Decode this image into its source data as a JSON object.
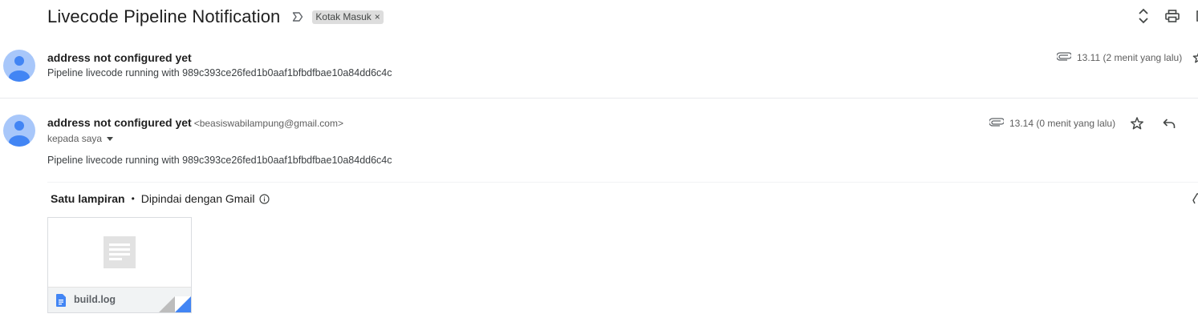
{
  "thread": {
    "subject": "Livecode Pipeline Notification",
    "label": "Kotak Masuk",
    "label_remove": "×"
  },
  "messages": [
    {
      "sender": "address not configured yet",
      "snippet": "Pipeline livecode running with 989c393ce26fed1b0aaf1bfbdfbae10a84dd6c4c",
      "time": "13.11 (2 menit yang lalu)"
    },
    {
      "sender": "address not configured yet",
      "email": "<beasiswabilampung@gmail.com>",
      "to": "kepada saya",
      "time": "13.14 (0 menit yang lalu)",
      "body": "Pipeline livecode running with 989c393ce26fed1b0aaf1bfbdfbae10a84dd6c4c"
    }
  ],
  "attachments": {
    "count_label": "Satu lampiran",
    "separator": "•",
    "scan_label": "Dipindai dengan Gmail",
    "files": [
      {
        "name": "build.log",
        "icon": "document-icon"
      }
    ]
  },
  "icons": {
    "importance": "label-important-outline-icon",
    "expand": "unfold-more-icon",
    "print": "print-icon",
    "new_window": "open-in-new-icon",
    "attachment": "paperclip-icon",
    "star": "star-outline-icon",
    "reply": "reply-icon",
    "info": "info-icon"
  },
  "colors": {
    "avatar_bg": "#a8c7fa",
    "avatar_fg": "#4285f4",
    "file_accent": "#4285f4",
    "chip_bg": "#dddddd"
  }
}
